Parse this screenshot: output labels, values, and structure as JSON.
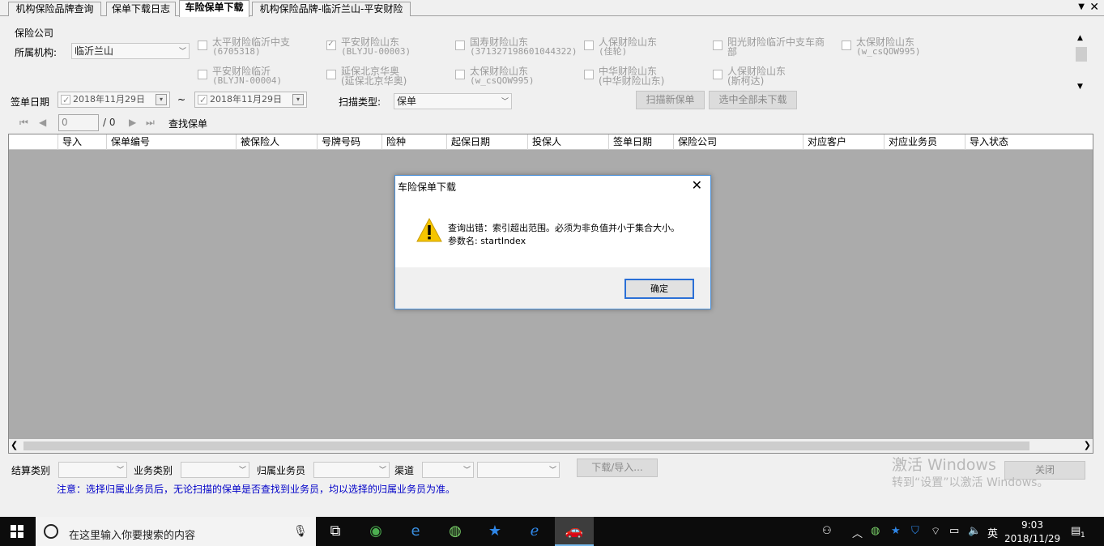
{
  "tabs": [
    {
      "label": "机构保险品牌查询"
    },
    {
      "label": "保单下载日志"
    },
    {
      "label": "车险保单下载"
    },
    {
      "label": "机构保险品牌-临沂兰山-平安财险"
    }
  ],
  "company_group": {
    "title": "保险公司",
    "org_label": "所属机构:",
    "org_value": "临沂兰山",
    "companies": [
      {
        "name": "太平财险临沂中支",
        "code": "(6705318)",
        "checked": false
      },
      {
        "name": "平安财险山东",
        "code": "(BLYJU-00003)",
        "checked": true
      },
      {
        "name": "国寿财险山东",
        "code": "(371327198601044322)",
        "checked": false
      },
      {
        "name": "人保财险山东",
        "code": "(佳轮)",
        "checked": false
      },
      {
        "name": "阳光财险临沂中支车商",
        "code": "部",
        "checked": false
      },
      {
        "name": "太保财险山东",
        "code": "(w_csQOW995)",
        "checked": false
      },
      {
        "name": "平安财险临沂",
        "code": "(BLYJN-00004)",
        "checked": false
      },
      {
        "name": "延保北京华奥",
        "code": "(延保北京华奥)",
        "checked": false
      },
      {
        "name": "太保财险山东",
        "code": "(w_csQOW995)",
        "checked": false
      },
      {
        "name": "中华财险山东",
        "code": "(中华财险山东)",
        "checked": false
      },
      {
        "name": "人保财险山东",
        "code": "(斯柯达)",
        "checked": false
      }
    ]
  },
  "filters": {
    "sign_date_label": "签单日期",
    "date_from": "2018年11月29日",
    "date_sep": "~",
    "date_to": "2018年11月29日",
    "scan_type_label": "扫描类型:",
    "scan_type_value": "保单",
    "scan_new_button": "扫描新保单",
    "select_all_button": "选中全部未下载"
  },
  "navigator": {
    "position": "0",
    "total": "/ 0",
    "find_label": "查找保单"
  },
  "grid": {
    "columns": [
      "导入",
      "保单编号",
      "被保险人",
      "号牌号码",
      "险种",
      "起保日期",
      "投保人",
      "签单日期",
      "保险公司",
      "对应客户",
      "对应业务员",
      "导入状态"
    ]
  },
  "bottom": {
    "settle_label": "结算类别",
    "biz_label": "业务类别",
    "salesman_label": "归属业务员",
    "channel_label": "渠道",
    "download_button": "下载/导入...",
    "close_button": "关闭",
    "note": "注意：选择归属业务员后，无论扫描的保单是否查找到业务员，均以选择的归属业务员为准。"
  },
  "watermark": {
    "line1": "激活 Windows",
    "line2": "转到“设置”以激活 Windows。"
  },
  "dialog": {
    "title": "车险保单下载",
    "message1": "查询出错：索引超出范围。必须为非负值并小于集合大小。",
    "message2": "参数名: startIndex",
    "ok_button": "确定"
  },
  "taskbar": {
    "search_placeholder": "在这里输入你要搜索的内容",
    "ime": "英",
    "time": "9:03",
    "date": "2018/11/29",
    "notification_count": "1"
  },
  "colors": {
    "accent": "#2a6fd6",
    "note_text": "#0000c8",
    "grid_bg": "#ababab",
    "warning": "#f5c400"
  }
}
